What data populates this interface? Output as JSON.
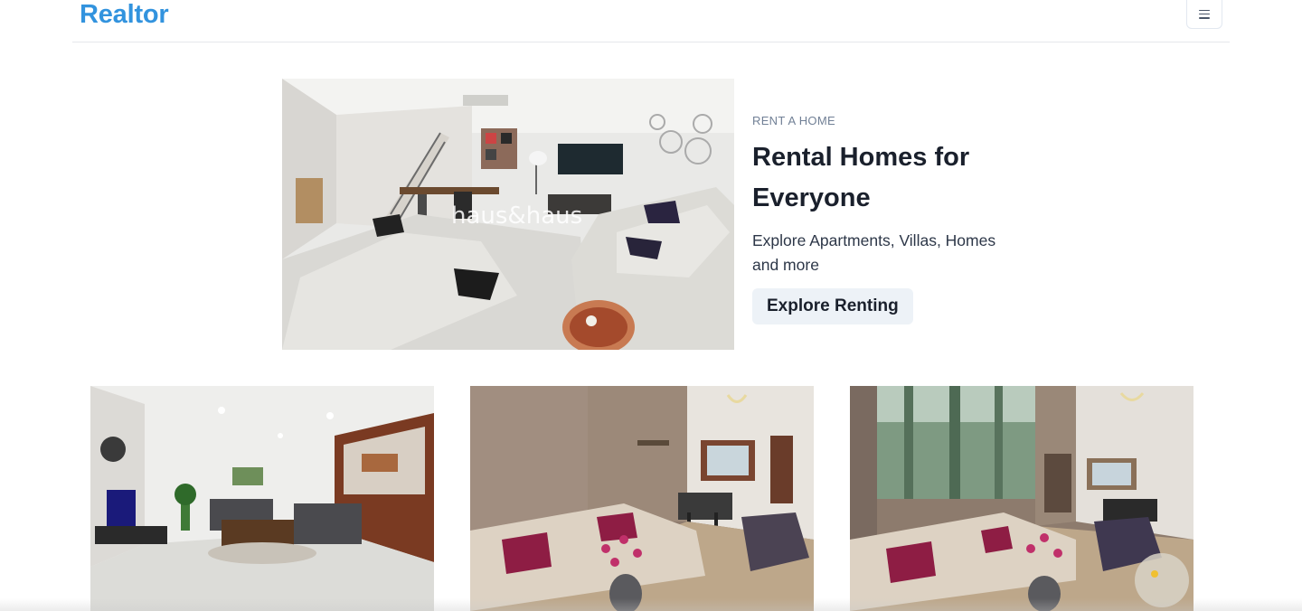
{
  "navbar": {
    "brand": "Realtor",
    "menu_icon": "hamburger-menu-icon"
  },
  "hero": {
    "image_alt": "Living room with grey sectional sofas",
    "watermark": "haus&haus",
    "eyebrow": "RENT A HOME",
    "title": "Rental Homes for Everyone",
    "description": "Explore Apartments, Villas, Homes and more",
    "cta_label": "Explore Renting"
  },
  "listings": [
    {
      "image_alt": "Living room with grey sofas and TV"
    },
    {
      "image_alt": "Living room with beige sectional and flowers"
    },
    {
      "image_alt": "Living room with forest mural and beige sofa"
    }
  ],
  "colors": {
    "brand": "#3293de",
    "button_bg": "#edf2f7",
    "text": "#1a202c",
    "muted": "#718096"
  }
}
